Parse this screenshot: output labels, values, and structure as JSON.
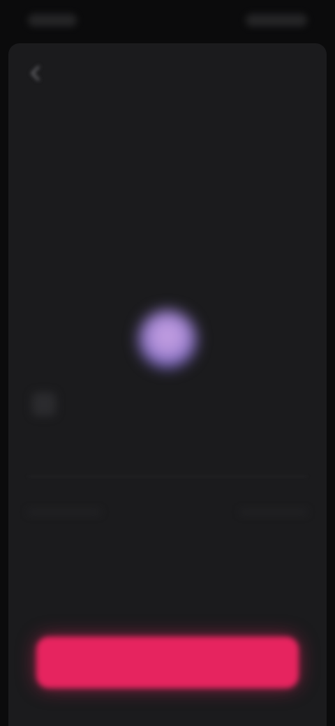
{
  "status_bar": {
    "time": "",
    "indicators": ""
  },
  "nav": {
    "back_icon": "chevron-left-icon",
    "title": ""
  },
  "rows": [
    {
      "label": "",
      "value": ""
    },
    {
      "label": "",
      "value": ""
    },
    {
      "label": "",
      "value": ""
    },
    {
      "label": "",
      "value": ""
    }
  ],
  "profile": {
    "name": ""
  },
  "choices": {
    "option_a": "",
    "option_b": ""
  },
  "primary_action": {
    "label": ""
  },
  "colors": {
    "background": "#0b0b0c",
    "sheet": "#1b1b1d",
    "accent": "#e6245f",
    "avatar": "#a98ad4"
  }
}
